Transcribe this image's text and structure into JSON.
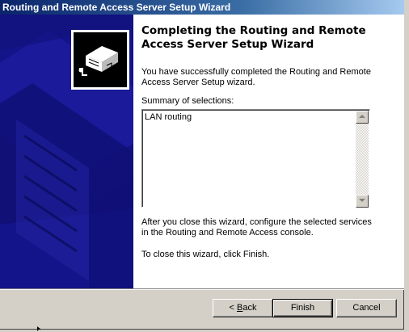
{
  "window": {
    "title": "Routing and Remote Access Server Setup Wizard"
  },
  "banner": {
    "icon": "network-server-wizard-icon",
    "accent_color": "#1a1a8c"
  },
  "main": {
    "heading_line1": "Completing the Routing and Remote",
    "heading_line2": "Access Server Setup Wizard",
    "intro_line1": "You have successfully completed the Routing and Remote",
    "intro_line2": "Access Server Setup wizard.",
    "summary_label": "Summary of selections:",
    "summary_value": "LAN routing",
    "after_line1": "After you close this wizard, configure the selected services",
    "after_line2": "in the Routing and  Remote Access console.",
    "close_text": "To close this wizard, click Finish."
  },
  "buttons": {
    "back_prefix": "< ",
    "back_accel": "B",
    "back_rest": "ack",
    "finish": "Finish",
    "cancel": "Cancel"
  }
}
